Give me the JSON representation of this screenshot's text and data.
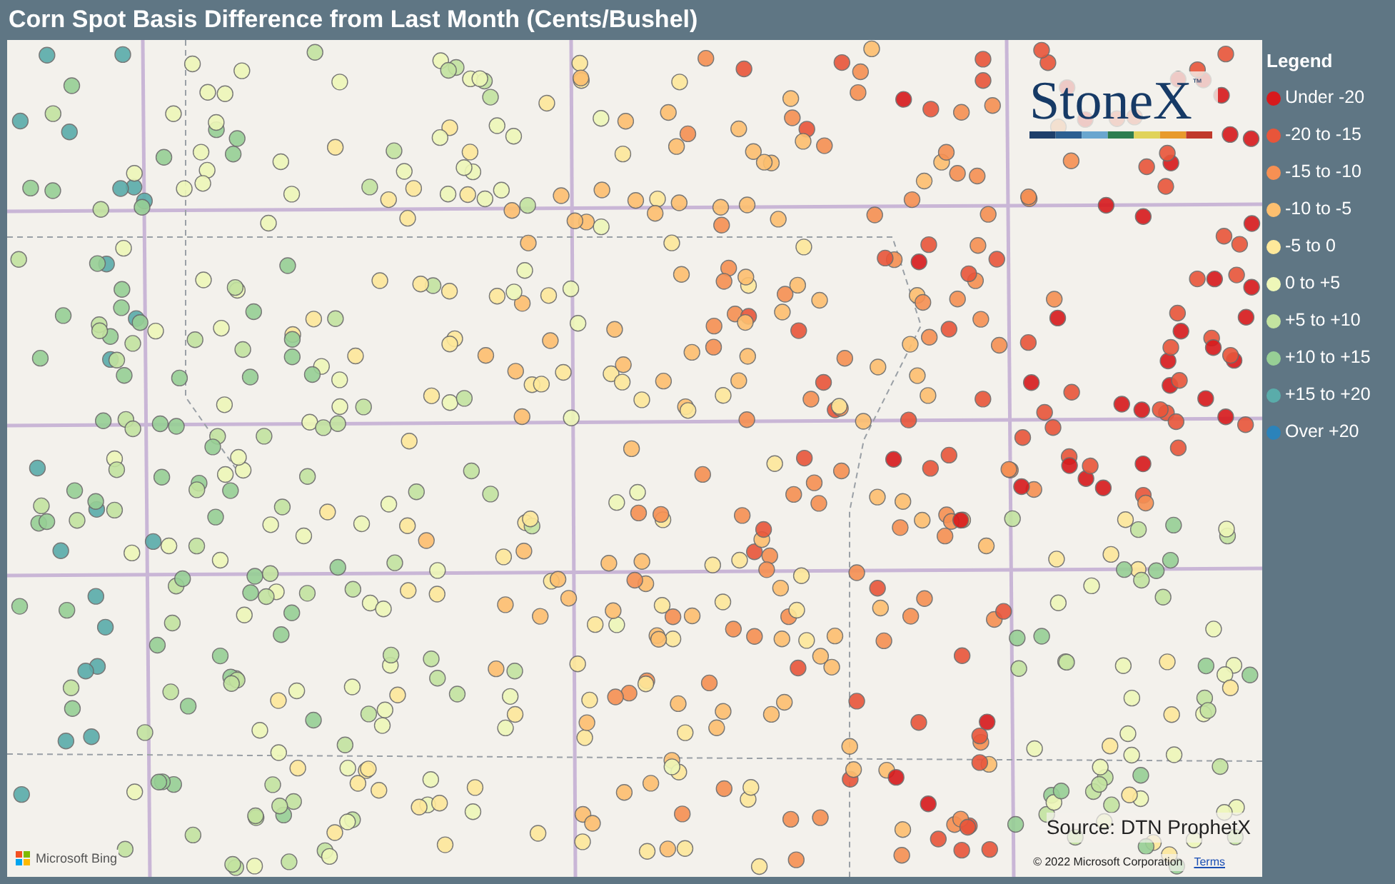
{
  "title": "Corn Spot Basis Difference from Last Month (Cents/Bushel)",
  "map": {
    "logo": {
      "text": "StoneX",
      "mark": "™"
    },
    "source": "Source: DTN ProphetX",
    "provider": "Microsoft Bing",
    "copyright": "© 2022 Microsoft Corporation",
    "terms": "Terms"
  },
  "legend": {
    "title": "Legend",
    "items": [
      {
        "label": "Under -20",
        "color": "#d7191c"
      },
      {
        "label": "-20 to -15",
        "color": "#e8553a"
      },
      {
        "label": "-15 to -10",
        "color": "#f69053"
      },
      {
        "label": "-10 to -5",
        "color": "#fdbf6f"
      },
      {
        "label": "-5 to 0",
        "color": "#fee89a"
      },
      {
        "label": "0 to +5",
        "color": "#eef7b8"
      },
      {
        "label": "+5 to +10",
        "color": "#c3e3a0"
      },
      {
        "label": "+10 to +15",
        "color": "#97cf95"
      },
      {
        "label": "+15 to +20",
        "color": "#5aacaa"
      },
      {
        "label": "Over +20",
        "color": "#2b83ba"
      }
    ]
  }
}
